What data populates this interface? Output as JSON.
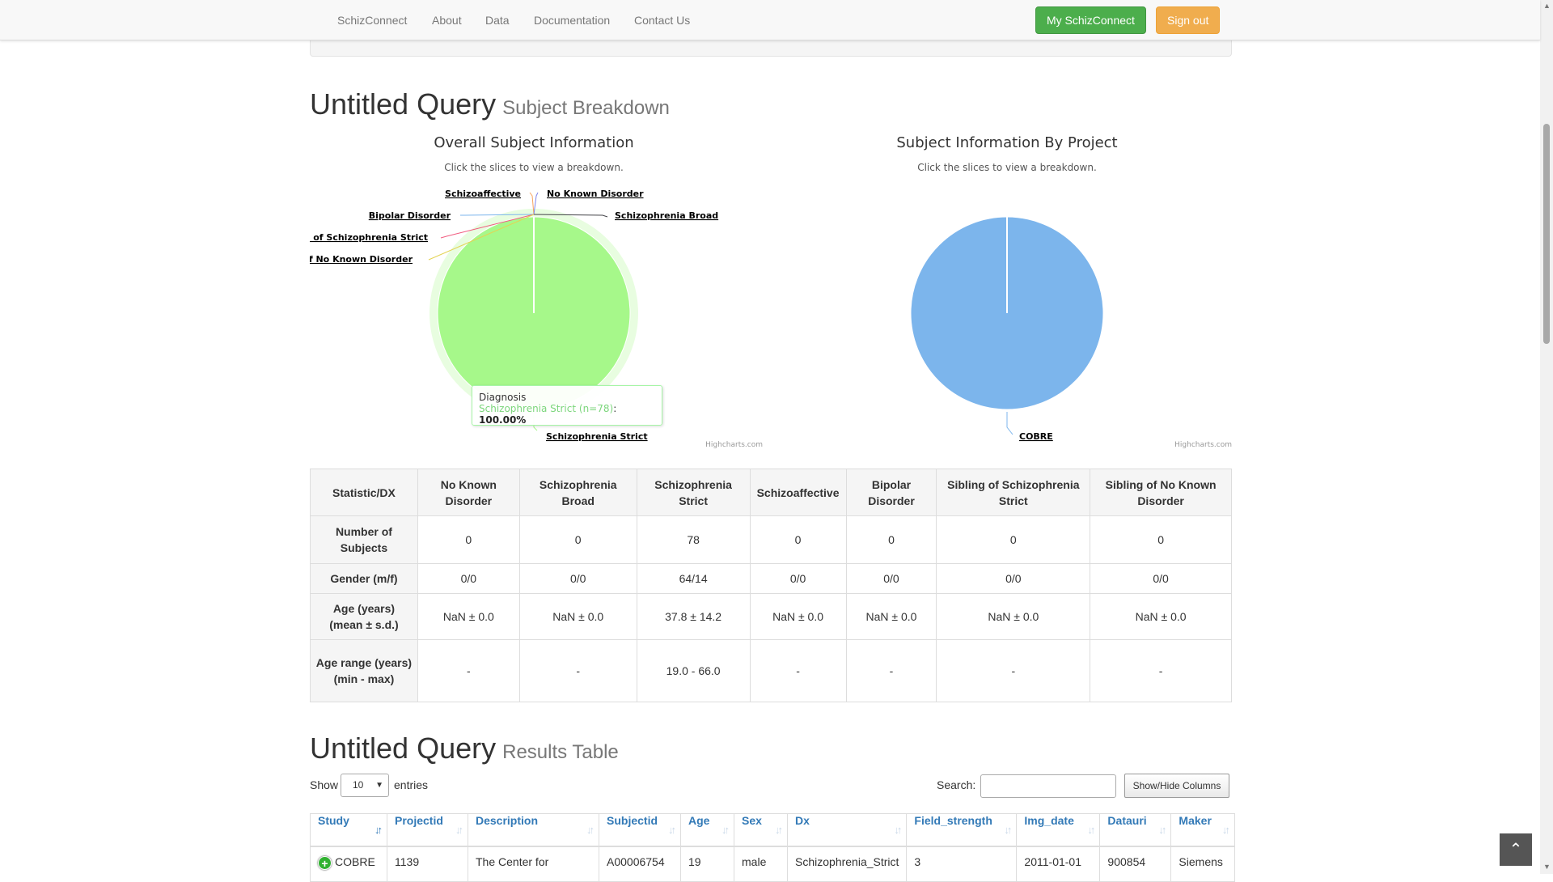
{
  "navbar": {
    "brand": "SchizConnect",
    "links": [
      "About",
      "Data",
      "Documentation",
      "Contact Us"
    ],
    "my_button": "My SchizConnect",
    "signout_button": "Sign out"
  },
  "breakdown": {
    "title": "Untitled Query",
    "subtitle": "Subject Breakdown"
  },
  "overall_chart": {
    "title": "Overall Subject Information",
    "subtitle": "Click the slices to view a breakdown.",
    "credits": "Highcharts.com",
    "labels": {
      "schizoaffective": "Schizoaffective",
      "no_known": "No Known Disorder",
      "bipolar": "Bipolar Disorder",
      "schiz_broad": "Schizophrenia Broad",
      "sib_strict": "Sibling of Schizophrenia Strict",
      "sib_no_known": "Sibling of No Known Disorder",
      "schiz_strict": "Schizophrenia Strict"
    },
    "tooltip": {
      "header": "Diagnosis",
      "series": "Schizophrenia Strict (n=78)",
      "value": "100.00%"
    },
    "color": "#a6f88a"
  },
  "project_chart": {
    "title": "Subject Information By Project",
    "subtitle": "Click the slices to view a breakdown.",
    "credits": "Highcharts.com",
    "label": "COBRE",
    "color": "#7cb5ec"
  },
  "chart_data": [
    {
      "type": "pie",
      "title": "Overall Subject Information",
      "categories": [
        "No Known Disorder",
        "Schizophrenia Broad",
        "Schizophrenia Strict",
        "Schizoaffective",
        "Bipolar Disorder",
        "Sibling of Schizophrenia Strict",
        "Sibling of No Known Disorder"
      ],
      "values": [
        0,
        0,
        78,
        0,
        0,
        0,
        0
      ]
    },
    {
      "type": "pie",
      "title": "Subject Information By Project",
      "categories": [
        "COBRE"
      ],
      "values": [
        78
      ]
    }
  ],
  "stats_table": {
    "headers": [
      "Statistic/DX",
      "No Known Disorder",
      "Schizophrenia Broad",
      "Schizophrenia Strict",
      "Schizoaffective",
      "Bipolar Disorder",
      "Sibling of Schizophrenia Strict",
      "Sibling of No Known Disorder"
    ],
    "rows": [
      {
        "label": "Number of Subjects",
        "values": [
          "0",
          "0",
          "78",
          "0",
          "0",
          "0",
          "0"
        ]
      },
      {
        "label": "Gender (m/f)",
        "values": [
          "0/0",
          "0/0",
          "64/14",
          "0/0",
          "0/0",
          "0/0",
          "0/0"
        ]
      },
      {
        "label": "Age (years) (mean ± s.d.)",
        "values": [
          "NaN ± 0.0",
          "NaN ± 0.0",
          "37.8 ± 14.2",
          "NaN ± 0.0",
          "NaN ± 0.0",
          "NaN ± 0.0",
          "NaN ± 0.0"
        ]
      },
      {
        "label": "Age range (years) (min - max)",
        "values": [
          "-",
          "-",
          "19.0 - 66.0",
          "-",
          "-",
          "-",
          "-"
        ]
      }
    ]
  },
  "results": {
    "title": "Untitled Query",
    "subtitle": "Results Table",
    "show_label": "Show",
    "entries_value": "10",
    "entries_label": "entries",
    "search_label": "Search:",
    "toggle_columns": "Show/Hide Columns",
    "columns": [
      "Study",
      "Projectid",
      "Description",
      "Subjectid",
      "Age",
      "Sex",
      "Dx",
      "Field_strength",
      "Img_date",
      "Datauri",
      "Maker"
    ],
    "rows": [
      [
        "COBRE",
        "1139",
        "The Center for",
        "A00006754",
        "19",
        "male",
        "Schizophrenia_Strict",
        "3",
        "2011-01-01",
        "900854",
        "Siemens"
      ]
    ]
  }
}
